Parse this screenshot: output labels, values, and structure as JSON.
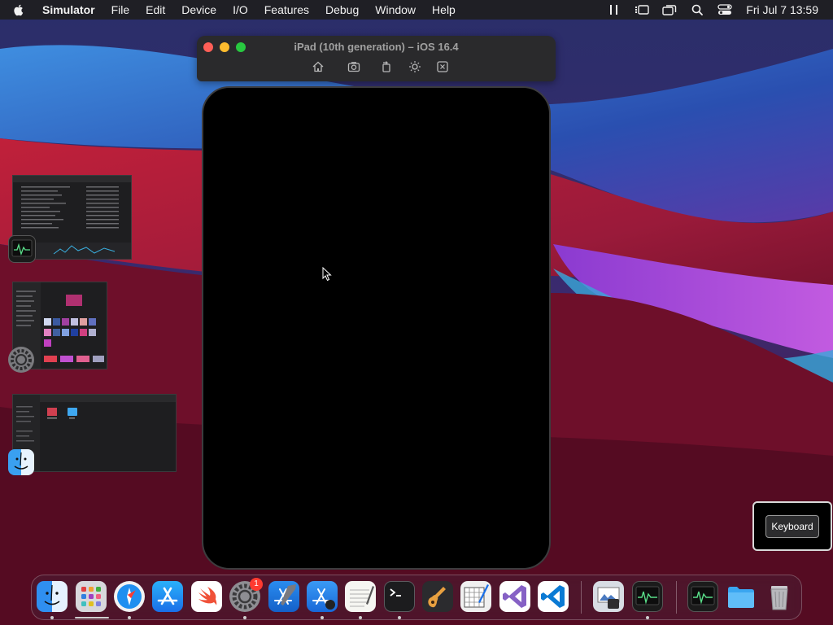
{
  "menubar": {
    "app_name": "Simulator",
    "items": [
      "File",
      "Edit",
      "Device",
      "I/O",
      "Features",
      "Debug",
      "Window",
      "Help"
    ],
    "datetime": "Fri Jul 7  13:59",
    "status_icons": [
      "sidebar-icon",
      "stage-manager-icon",
      "screen-mirroring-icon",
      "search-icon",
      "control-center-icon"
    ]
  },
  "simulator": {
    "title": "iPad (10th generation) – iOS 16.4",
    "toolbar": [
      "home-icon",
      "screenshot-icon",
      "rotate-icon",
      "appearance-icon",
      "keyboard-shortcut-icon"
    ]
  },
  "stage_manager": {
    "windows": [
      "activity-monitor",
      "system-settings",
      "finder"
    ]
  },
  "keyboard_overlay": {
    "label": "Keyboard"
  },
  "dock": {
    "apps": [
      "finder",
      "launchpad",
      "safari",
      "app-store",
      "swift-playgrounds",
      "system-settings",
      "xcode",
      "xcode-instruments",
      "textedit",
      "terminal",
      "garageband",
      "sketch",
      "visual-studio",
      "vs-code",
      "preview",
      "activity-monitor",
      "activity-monitor-2",
      "downloads-folder",
      "trash"
    ],
    "settings_badge": "1"
  },
  "colors": {
    "accent": "#0a84ff",
    "badge": "#ff3b30",
    "close": "#ff5f57",
    "minimize": "#febc2e",
    "zoom": "#28c840"
  }
}
